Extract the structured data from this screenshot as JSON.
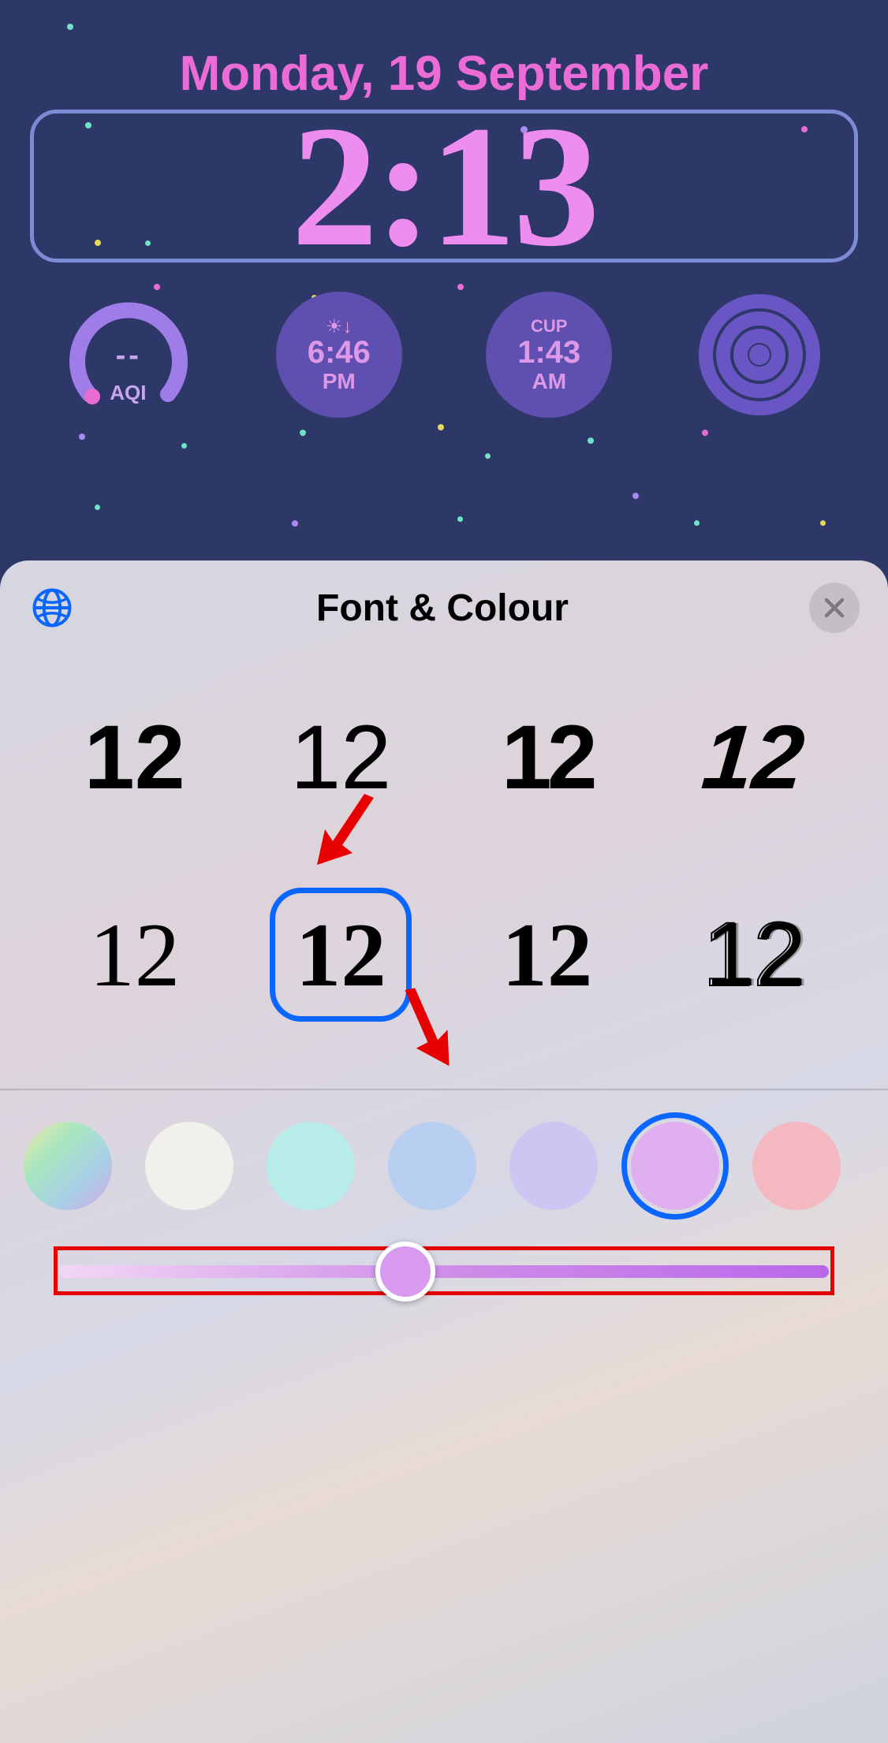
{
  "date_line": "Monday, 19 September",
  "clock_time": "2:13",
  "widgets": {
    "aqi": {
      "value": "--",
      "label": "AQI"
    },
    "sunset": {
      "time": "6:46",
      "period": "PM"
    },
    "world_clock": {
      "city": "CUP",
      "time": "1:43",
      "period": "AM"
    }
  },
  "sheet": {
    "title": "Font & Colour",
    "font_sample": "12",
    "fonts": [
      {
        "id": "f1",
        "selected": false
      },
      {
        "id": "f2",
        "selected": false
      },
      {
        "id": "f3",
        "selected": false
      },
      {
        "id": "f4",
        "selected": false
      },
      {
        "id": "f5",
        "selected": false
      },
      {
        "id": "f6",
        "selected": true
      },
      {
        "id": "f7",
        "selected": false
      },
      {
        "id": "f8",
        "selected": false
      }
    ],
    "colors": [
      {
        "id": "c0",
        "hex": "gradient",
        "selected": false
      },
      {
        "id": "c1",
        "hex": "#f2f0ea",
        "selected": false
      },
      {
        "id": "c2",
        "hex": "#b8ece9",
        "selected": false
      },
      {
        "id": "c3",
        "hex": "#b8cff1",
        "selected": false
      },
      {
        "id": "c4",
        "hex": "#cfc5f3",
        "selected": false
      },
      {
        "id": "c5",
        "hex": "#dfaff0",
        "selected": true
      },
      {
        "id": "c6",
        "hex": "#f3b8c0",
        "selected": false
      }
    ],
    "slider": {
      "value": 45,
      "min": 0,
      "max": 100
    }
  },
  "annotation_color": "#e60000"
}
